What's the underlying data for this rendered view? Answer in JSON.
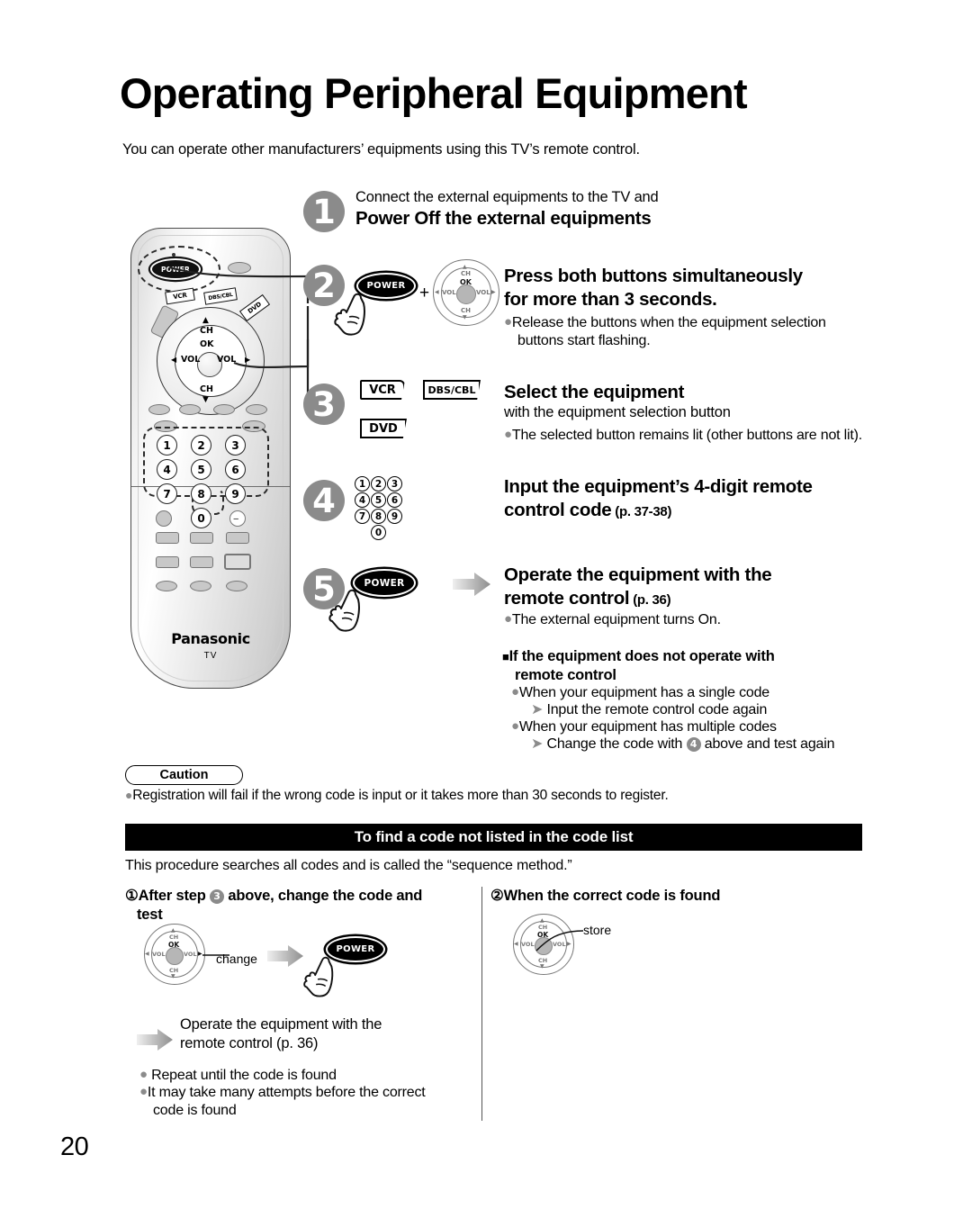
{
  "document": {
    "title": "Operating Peripheral Equipment",
    "intro": "You can operate other manufacturers’ equipments using this TV’s remote control.",
    "page_number": "20"
  },
  "remote": {
    "power_label": "POWER",
    "mode_buttons": [
      "VCR",
      "DBS/CBL",
      "DVD"
    ],
    "navpad": {
      "ok": "OK",
      "up": "CH",
      "down": "CH",
      "left": "VOL",
      "right": "VOL"
    },
    "keypad": [
      "1",
      "2",
      "3",
      "4",
      "5",
      "6",
      "7",
      "8",
      "9",
      "0"
    ],
    "brand": "Panasonic",
    "brand_sub": "TV"
  },
  "steps": [
    {
      "number": "1",
      "lead": "Connect the external equipments to the TV and",
      "heading": "Power Off the external equipments",
      "sub": "",
      "page_ref": "",
      "bullets": []
    },
    {
      "number": "2",
      "lead": "",
      "heading_line1": "Press both buttons simultaneously",
      "heading_line2": "for more than 3 seconds.",
      "sub": "",
      "page_ref": "",
      "bullets": [
        "Release the buttons when the equipment selection buttons start flashing."
      ],
      "power_label": "POWER",
      "plus": "+"
    },
    {
      "number": "3",
      "heading": "Select the equipment",
      "sub": "with the equipment selection button",
      "bullets": [
        "The selected button remains lit (other buttons are not lit)."
      ],
      "buttons": [
        "VCR",
        "DBS/CBL",
        "DVD"
      ]
    },
    {
      "number": "4",
      "heading_line1": "Input the equipment’s 4-digit remote",
      "heading_line2": "control code",
      "page_ref": "(p. 37-38)",
      "bullets": [],
      "keypad": [
        "1",
        "2",
        "3",
        "4",
        "5",
        "6",
        "7",
        "8",
        "9",
        "0"
      ]
    },
    {
      "number": "5",
      "heading_line1": "Operate the equipment with the",
      "heading_line2": "remote control",
      "page_ref": "(p. 36)",
      "bullets": [
        "The external equipment turns On."
      ],
      "power_label": "POWER"
    }
  ],
  "troubleshoot": {
    "heading_line1": "If the equipment does not operate with",
    "heading_line2": "remote control",
    "items": [
      {
        "bullet": "When your equipment has a single code",
        "arrow": "Input the remote control code again"
      },
      {
        "bullet": "When your equipment has multiple codes",
        "arrow_pre": "Change the code with",
        "arrow_num": "4",
        "arrow_post": "above and test again"
      }
    ]
  },
  "caution": {
    "label": "Caution",
    "text": "Registration will fail if the wrong code is input or it takes more than 30 seconds to register."
  },
  "find_code": {
    "band_title": "To find a code not listed in the code list",
    "note": "This procedure searches all codes and is called the “sequence method.”",
    "left": {
      "heading_pre": "①",
      "heading_a": "After step",
      "heading_num": "3",
      "heading_b": "above, change the code and",
      "heading_line2": "test",
      "change_label": "change",
      "power_label": "POWER",
      "operate_line1": "Operate the equipment with the",
      "operate_line2": "remote control (p. 36)",
      "bullets": [
        "Repeat until the code is found",
        "It may take many attempts before the correct code is found"
      ]
    },
    "right": {
      "heading": "②When the correct code is found",
      "store_label": "store",
      "navpad": {
        "ok": "OK",
        "up": "CH",
        "down": "CH",
        "left": "VOL",
        "right": "VOL"
      }
    }
  },
  "colors": {
    "step_circle": "#8b8b8b",
    "band_bg": "#000000",
    "bullet_dot": "#8b8b8b"
  }
}
